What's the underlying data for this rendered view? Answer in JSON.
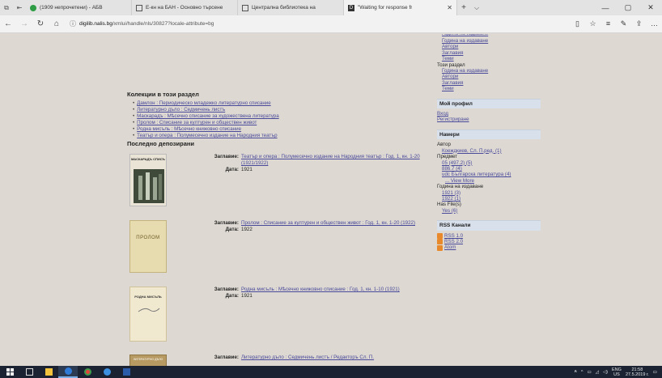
{
  "browser": {
    "tabs": [
      {
        "title": "(1909 непрочетени) - АБВ",
        "active": false,
        "favicon_color": "#2e9d45"
      },
      {
        "title": "Е-кн на БАН - Основно търсене",
        "active": false,
        "favicon_color": "#555555"
      },
      {
        "title": "Централна библиотека на",
        "active": false,
        "favicon_color": "#555555"
      },
      {
        "title": "\"Waiting for response fr",
        "active": true,
        "favicon_color": "#333333"
      }
    ],
    "url_host": "digilib.nalis.bg",
    "url_path": "/xmlui/handle/nls/30827?locale-attribute=bg"
  },
  "collections": {
    "heading": "Колекции в този раздел",
    "items": [
      "Дамлон : Периодическо младежко литературно списание",
      "Литературно дъло : Седмичень листъ",
      "Маскарадъ : Мѣсечно списание за художествена литература",
      "Пролом : Списание за културен и обществен живот",
      "Родна мисъль : Мѣсечно книжовно списание",
      "Театър и опера : Полумесечно издание на Народния театър"
    ]
  },
  "recent": {
    "heading": "Последно депозирани",
    "title_label": "Заглавие:",
    "date_label": "Дата:",
    "items": [
      {
        "title": "Театър и опера : Полумесечно издание на Народния театър : Год. 1, кн. 1-20 (1921/1922)",
        "date": "1921",
        "cover_label": "МАСКАРАДЪ СПИСЪ"
      },
      {
        "title": "Пролом : Списание за културен и обществен живот : Год. 1, кн. 1-20 (1922)",
        "date": "1922",
        "cover_label": "ПРОЛОМ"
      },
      {
        "title": "Родна мисъль : Мѣсечно книжовно списание : Год. 1, кн. 1-10 (1921)",
        "date": "1921",
        "cover_label": "РОДНА МИСЪЛЬ"
      },
      {
        "title": "Литературно дъло : Седмичень листъ / Редакторъ Сл. П.",
        "date": "",
        "cover_label": "ЛИТЕРАТУРНО ДѢЛО"
      }
    ]
  },
  "sidebar": {
    "top_links": [
      "Година на издаване",
      "Автори",
      "Заглавия",
      "Теми"
    ],
    "this_section_label": "Този раздел",
    "this_section_links": [
      "Година на издаване",
      "Автори",
      "Заглавия",
      "Теми"
    ],
    "profile_heading": "Мой профил",
    "profile_links": [
      "Вход",
      "Регистриране"
    ],
    "discover_heading": "Намери",
    "author_label": "Автор",
    "author_values": [
      "Коеждкиев, Сл. П.ред. (1)"
    ],
    "subject_label": "Предмет",
    "subject_values": [
      "05 (497.2) (5)",
      "886.7 (4)",
      "udc Българска литература (4)",
      "... View More"
    ],
    "year_label": "Година на издаване",
    "year_values": [
      "1921 (3)",
      "1922 (1)"
    ],
    "files_label": "Has File(s)",
    "files_values": [
      "Yes (6)"
    ],
    "rss_heading": "RSS Канали",
    "rss_links": [
      "RSS 1.0",
      "RSS 2.0",
      "Atom"
    ]
  },
  "taskbar": {
    "lang": "ENG",
    "region": "US",
    "time": "21:58",
    "date": "27.5.2019 г."
  }
}
